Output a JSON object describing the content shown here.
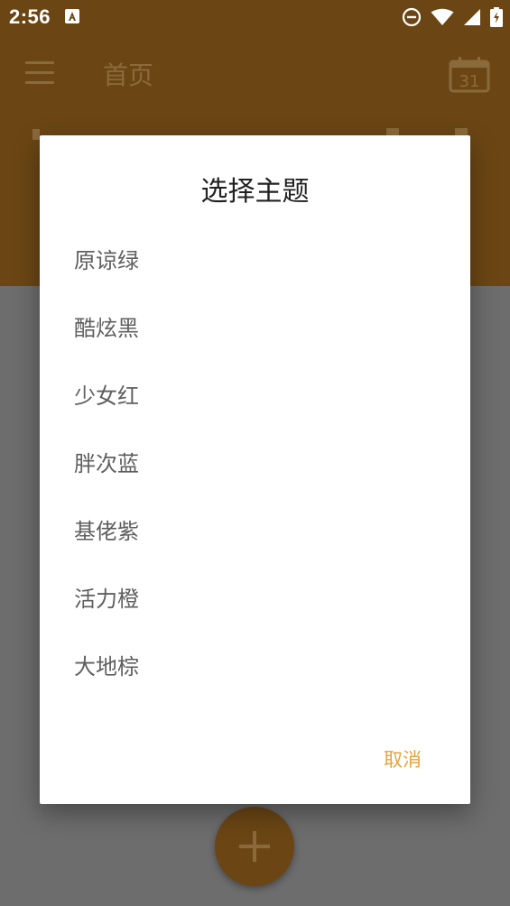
{
  "status_bar": {
    "time": "2:56",
    "icons": [
      "a-notification-icon",
      "do-not-disturb-icon",
      "wifi-icon",
      "signal-icon",
      "battery-charging-icon"
    ]
  },
  "toolbar": {
    "title": "首页",
    "calendar_day": "31",
    "menu_icon": "menu-icon",
    "calendar_icon": "calendar-icon"
  },
  "dialog": {
    "title": "选择主题",
    "options": [
      {
        "label": "原谅绿"
      },
      {
        "label": "酷炫黑"
      },
      {
        "label": "少女红"
      },
      {
        "label": "胖次蓝"
      },
      {
        "label": "基佬紫"
      },
      {
        "label": "活力橙"
      },
      {
        "label": "大地棕"
      }
    ],
    "cancel_label": "取消"
  },
  "fab": {
    "icon": "plus-icon"
  },
  "colors": {
    "app_bar": "#6b4614",
    "scrim_background": "#6d6d6d",
    "dialog_background": "#ffffff",
    "accent": "#e8a33c",
    "option_text": "#5f5f5f",
    "title_text": "#212121"
  }
}
